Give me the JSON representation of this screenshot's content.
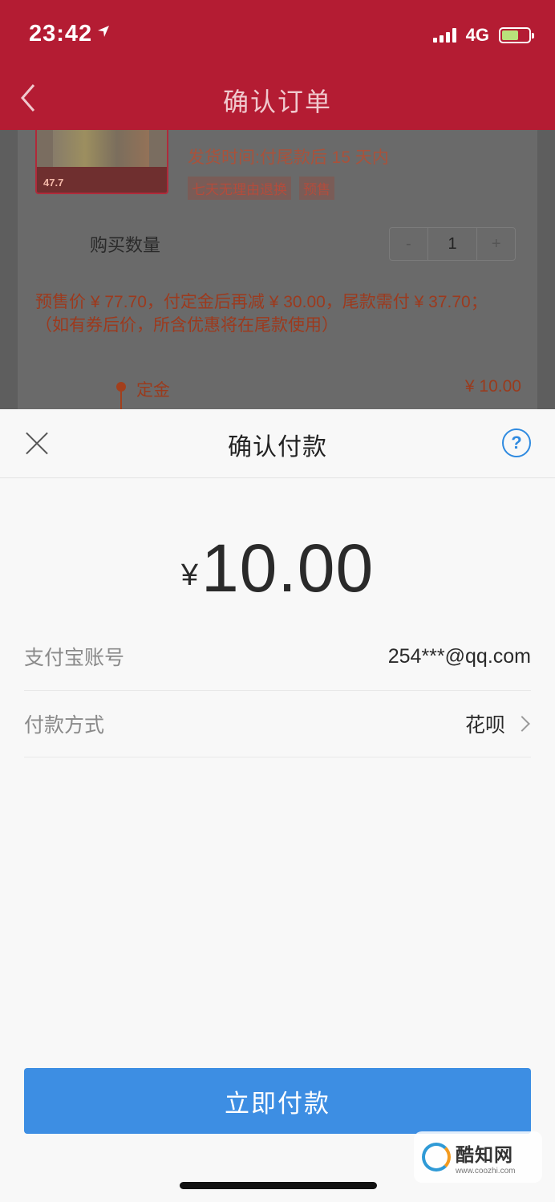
{
  "status_bar": {
    "time": "23:42",
    "network": "4G"
  },
  "nav": {
    "title": "确认订单"
  },
  "order": {
    "thumb_price": "47.7",
    "ship_time": "发货时间:付尾款后 15 天内",
    "tags": [
      "七天无理由退换",
      "预售"
    ],
    "quantity_label": "购买数量",
    "quantity_minus": "-",
    "quantity_value": "1",
    "quantity_plus": "+",
    "presale_text": "预售价 ¥ 77.70，付定金后再减 ¥ 30.00，尾款需付 ¥ 37.70；（如有券后价，所含优惠将在尾款使用）",
    "deposit_label": "定金",
    "deposit_value": "¥ 10.00"
  },
  "payment_sheet": {
    "title": "确认付款",
    "help_label": "?",
    "currency": "¥",
    "amount": "10.00",
    "account_label": "支付宝账号",
    "account_value": "254***@qq.com",
    "method_label": "付款方式",
    "method_value": "花呗",
    "pay_button": "立即付款"
  },
  "watermark": {
    "name": "酷知网",
    "url": "www.coozhi.com"
  },
  "colors": {
    "header": "#b41c33",
    "accent": "#3d8ee3",
    "help": "#2f8ae0"
  }
}
